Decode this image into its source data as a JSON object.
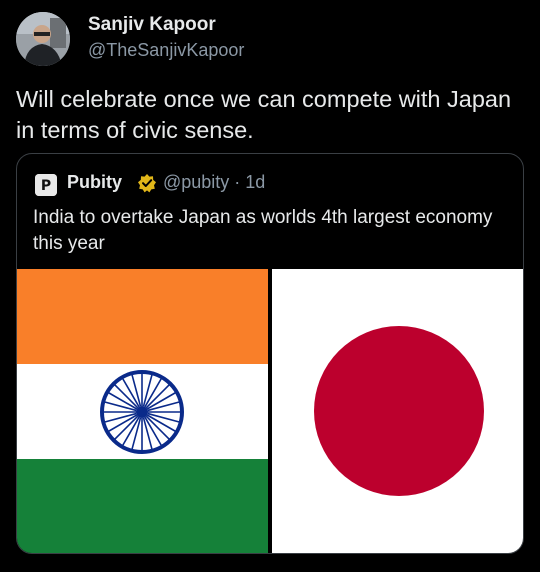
{
  "author": {
    "name": "Sanjiv Kapoor",
    "handle": "@TheSanjivKapoor"
  },
  "tweet": {
    "text": "Will celebrate once we can compete with Japan in terms of civic sense."
  },
  "quote": {
    "name": "Pubity",
    "handle": "@pubity",
    "separator": "·",
    "time": "1d",
    "meta": "@pubity · 1d",
    "text": "India to overtake Japan as worlds 4th largest economy this year",
    "badge": "verified-gold-icon"
  },
  "media": {
    "left": "india-flag",
    "right": "japan-flag"
  },
  "colors": {
    "background": "#000000",
    "text_primary": "#e7e9ea",
    "text_secondary": "#8b98a5",
    "border": "#3a3f44",
    "saffron": "#f97f29",
    "india_green": "#158139",
    "chakra_blue": "#0a2a8a",
    "japan_red": "#bc002d",
    "badge_gold": "#e2b719"
  }
}
